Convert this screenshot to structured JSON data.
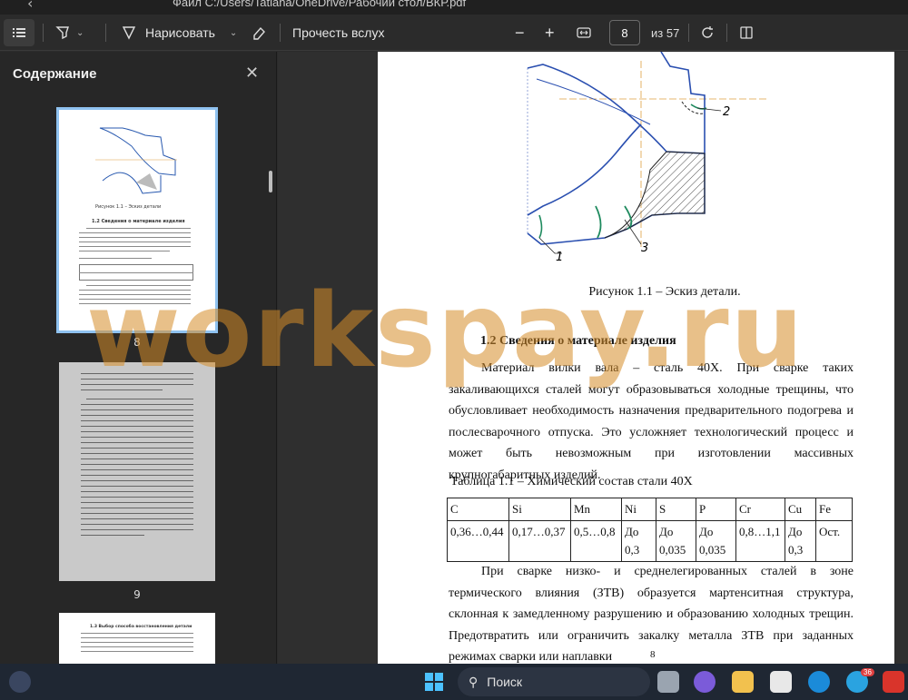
{
  "titlebar": {
    "file_path": "Файл   C:/Users/Tatiana/OneDrive/Рабочий стол/ВКР.pdf"
  },
  "toolbar": {
    "draw_label": "Нарисовать",
    "read_aloud_label": "Прочесть вслух",
    "page_value": "8",
    "page_total": "из 57"
  },
  "sidebar": {
    "title": "Содержание",
    "thumbnails": [
      {
        "label": "8",
        "selected": true
      },
      {
        "label": "9",
        "selected": false
      }
    ],
    "thumb1": {
      "caption": "Рисунок 1.1 – Эскиз детали",
      "heading": "1.2 Сведения о материале изделия"
    },
    "thumb3": {
      "heading": "1.3 Выбор способа восстановления детали"
    }
  },
  "document": {
    "figure_labels": [
      "2",
      "1",
      "3"
    ],
    "figure_caption": "Рисунок 1.1 – Эскиз детали.",
    "section_heading": "1.2 Сведения о материале изделия",
    "paragraph1": "Материал вилки вала – сталь 40Х. При сварке таких закаливающихся сталей могут образовываться холодные трещины, что обусловливает необходимость назначения предварительного подогрева и послесварочного отпуска. Это усложняет технологический процесс и может быть невозможным при изготовлении массивных крупногабаритных изделий.",
    "table_caption": "Таблица 1.1 – Химический состав стали 40Х",
    "table": {
      "headers": [
        "C",
        "Si",
        "Mn",
        "Ni",
        "S",
        "P",
        "Cr",
        "Cu",
        "Fe"
      ],
      "values": [
        "0,36…0,44",
        "0,17…0,37",
        "0,5…0,8",
        "До 0,3",
        "До 0,035",
        "До 0,035",
        "0,8…1,1",
        "До 0,3",
        "Ост."
      ]
    },
    "paragraph2": "При сварке низко- и среднелегированных сталей в зоне термического влияния (ЗТВ) образуется мартенситная структура, склонная к замедленному разрушению и образованию холодных трещин. Предотвратить или ограничить закалку металла ЗТВ при заданных режимах сварки или наплавки",
    "page_number": "8"
  },
  "watermark": "workspay.ru",
  "taskbar": {
    "search_label": "Поиск",
    "telegram_badge": "36"
  }
}
